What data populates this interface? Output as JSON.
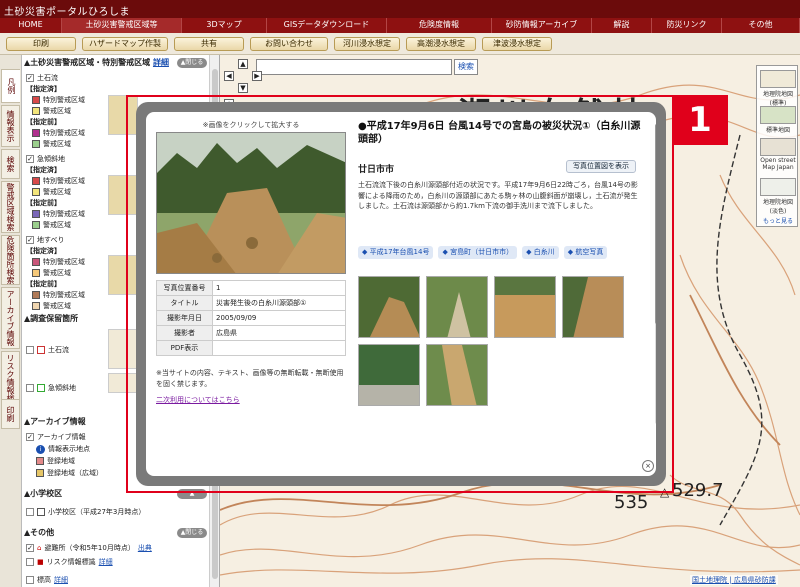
{
  "header": {
    "site_title": "土砂災害ポータルひろしま"
  },
  "nav": [
    {
      "label": "HOME",
      "active": false
    },
    {
      "label": "土砂災害警戒区域等",
      "active": true
    },
    {
      "label": "3Dマップ",
      "active": false
    },
    {
      "label": "GISデータダウンロード",
      "active": false
    },
    {
      "label": "危険度情報",
      "active": false
    },
    {
      "label": "砂防情報アーカイブ",
      "active": false
    },
    {
      "label": "解説",
      "active": false
    },
    {
      "label": "防災リンク",
      "active": false
    },
    {
      "label": "その他",
      "active": false
    }
  ],
  "toolbar": [
    {
      "label": "印刷"
    },
    {
      "label": "ハザードマップ作製"
    },
    {
      "label": "共有"
    },
    {
      "label": "お問い合わせ"
    },
    {
      "label": "河川浸水想定"
    },
    {
      "label": "高潮浸水想定"
    },
    {
      "label": "津波浸水想定"
    }
  ],
  "side_tabs": [
    {
      "label": "凡例",
      "active": true
    },
    {
      "label": "情報表示",
      "active": false
    },
    {
      "label": "検索",
      "active": false
    },
    {
      "label": "警戒区域検索",
      "active": false
    },
    {
      "label": "危険箇所検索",
      "active": false
    },
    {
      "label": "アーカイブ情報検索",
      "active": false
    },
    {
      "label": "リスク情報検索",
      "active": false
    },
    {
      "label": "印刷",
      "active": false
    }
  ],
  "legend": {
    "section1_title": "土砂災害警戒区域・特別警戒区域",
    "section1_detail": "詳細",
    "section1_close": "▲閉じる",
    "group_dosekiryu": "土石流",
    "group_kyukeisha": "急傾斜地",
    "group_jisuberi": "地すべり",
    "designated": "【指定済】",
    "planned": "【指定前】",
    "special": "特別警戒区域",
    "warning": "警戒区域",
    "section2_title": "調査保留箇所",
    "s2_dosekiryu": "土石流",
    "s2_kyukeisha": "急傾斜地",
    "section3_title": "アーカイブ情報",
    "archive_info": "アーカイブ情報",
    "archive_point": "情報表示地点",
    "archive_area": "登録地域",
    "archive_area_wide": "登録地域（広域）",
    "section4_title": "小学校区",
    "school_item": "小学校区（平成27年3月時点）",
    "section5_title": "その他",
    "other_close": "▲閉じる",
    "evac": "避難所（令和5年10月時点）",
    "evac_link": "出典",
    "risk": "リスク情報標識",
    "risk_link": "詳細",
    "last": "標高",
    "last_link": "詳細"
  },
  "map": {
    "search_placeholder": "",
    "search_button": "検索",
    "place_label": "瀬川自然林",
    "elev_label": "529.7",
    "elev_label2": "535",
    "attribution": "国土地理院",
    "attribution2": "広島県砂防課",
    "basemaps": [
      {
        "label": "地理院地図(標準)"
      },
      {
        "label": "標準地図"
      },
      {
        "label": "Open street Map Japan"
      },
      {
        "label": "地理院地図(淡色)"
      },
      {
        "label": "もっと見る"
      }
    ]
  },
  "annotation": {
    "badge": "1"
  },
  "popup": {
    "photo_hint": "※画像をクリックして拡大する",
    "title": "●平成17年9月6日 台風14号での宮島の被災状況①（白糸川源頭部）",
    "municipality": "廿日市市",
    "location_button": "写真位置図を表示",
    "description": "土石流流下後の白糸川源頭部付近の状況です。平成17年9月6日22時ごろ，台風14号の影響による降雨のため，白糸川の源頭部にあたる駒ヶ林の山腹斜面が崩壊し，土石流が発生しました。土石流は源頭部から約1.7km下流の御手洗川まで流下しました。",
    "tags": [
      "平成17年台風14号",
      "宮島町（廿日市市）",
      "白糸川",
      "航空写真"
    ],
    "table": [
      {
        "key": "写真位置番号",
        "value": "1"
      },
      {
        "key": "タイトル",
        "value": "災害発生後の白糸川源頭部①"
      },
      {
        "key": "撮影年月日",
        "value": "2005/09/09"
      },
      {
        "key": "撮影者",
        "value": "広島県"
      },
      {
        "key": "PDF表示",
        "value": ""
      }
    ],
    "notice": "※当サイトの内容、テキスト、画像等の無断転載・無断使用を固く禁じます。",
    "reuse_link": "二次利用についてはこちら",
    "close": "×"
  },
  "colors": {
    "header_bg": "#6b0b0b",
    "nav_bg": "#8e1111",
    "highlight": "#e0001b",
    "tag_bg": "#dfe8f6",
    "link": "#1a4fb0"
  }
}
